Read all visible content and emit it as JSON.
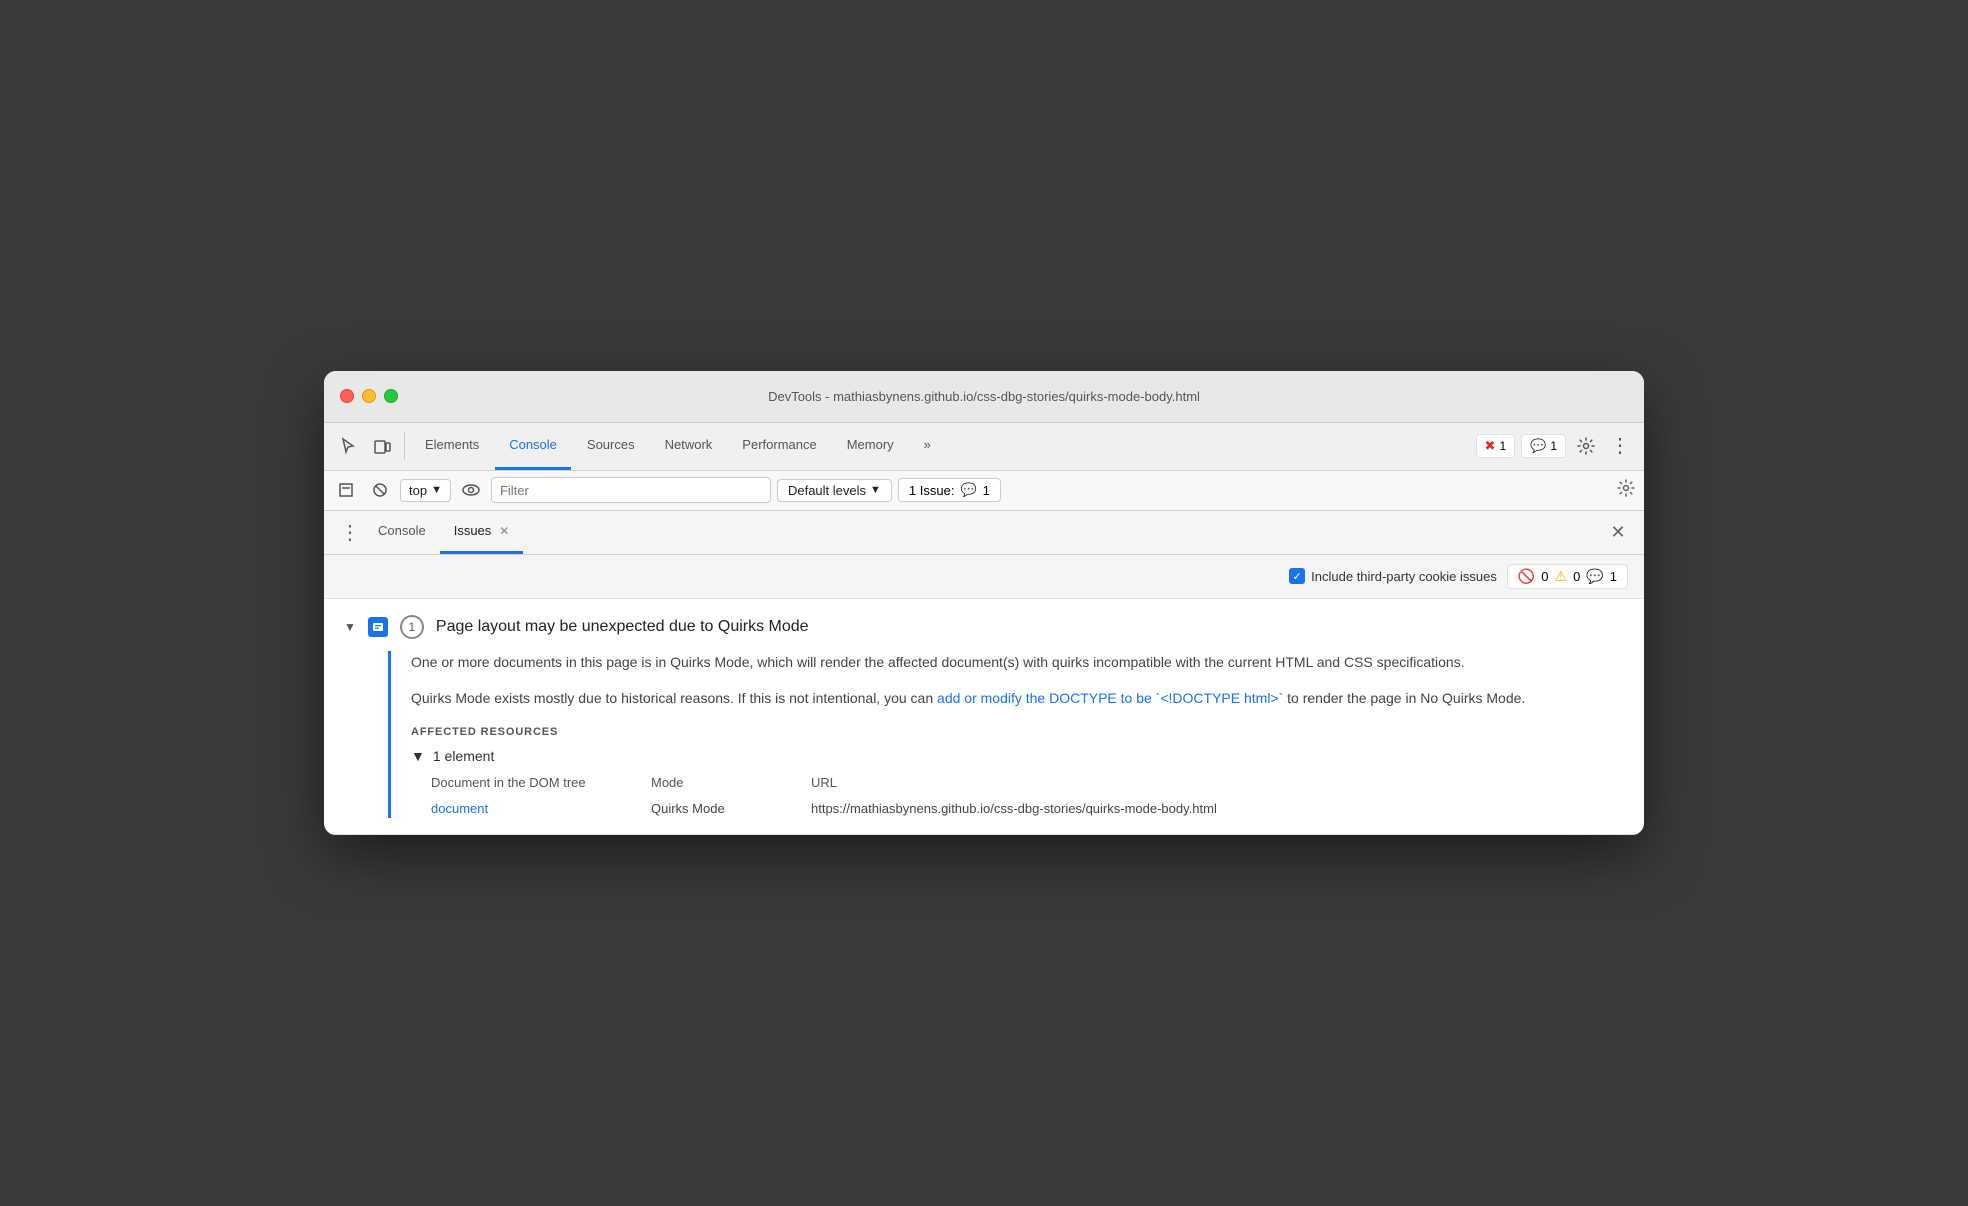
{
  "window": {
    "title": "DevTools - mathiasbynens.github.io/css-dbg-stories/quirks-mode-body.html"
  },
  "toolbar": {
    "tabs": [
      {
        "id": "elements",
        "label": "Elements",
        "active": false
      },
      {
        "id": "console",
        "label": "Console",
        "active": true
      },
      {
        "id": "sources",
        "label": "Sources",
        "active": false
      },
      {
        "id": "network",
        "label": "Network",
        "active": false
      },
      {
        "id": "performance",
        "label": "Performance",
        "active": false
      },
      {
        "id": "memory",
        "label": "Memory",
        "active": false
      }
    ],
    "more_label": "»",
    "error_count": "1",
    "info_count": "1"
  },
  "console_toolbar": {
    "top_label": "top",
    "filter_placeholder": "Filter",
    "default_levels": "Default levels",
    "issue_label": "1 Issue:",
    "issue_count": "1"
  },
  "panel_tabs": [
    {
      "id": "console-tab",
      "label": "Console",
      "closeable": false,
      "active": false
    },
    {
      "id": "issues-tab",
      "label": "Issues",
      "closeable": true,
      "active": true
    }
  ],
  "issues_filter": {
    "checkbox_label": "Include third-party cookie issues",
    "error_count": "0",
    "warning_count": "0",
    "info_count": "1"
  },
  "issue": {
    "title": "Page layout may be unexpected due to Quirks Mode",
    "count": "1",
    "description_1": "One or more documents in this page is in Quirks Mode, which will render the affected document(s) with quirks incompatible with the current HTML and CSS specifications.",
    "description_2_before": "Quirks Mode exists mostly due to historical reasons. If this is not intentional, you can ",
    "description_2_link": "add or modify the DOCTYPE to be `<!DOCTYPE html>`",
    "description_2_after": " to render the page in No Quirks Mode.",
    "affected_label": "AFFECTED RESOURCES",
    "element_count": "1 element",
    "col_document": "Document in the DOM tree",
    "col_mode": "Mode",
    "col_url": "URL",
    "row_doc_link": "document",
    "row_mode": "Quirks Mode",
    "row_url": "https://mathiasbynens.github.io/css-dbg-stories/quirks-mode-body.html"
  }
}
